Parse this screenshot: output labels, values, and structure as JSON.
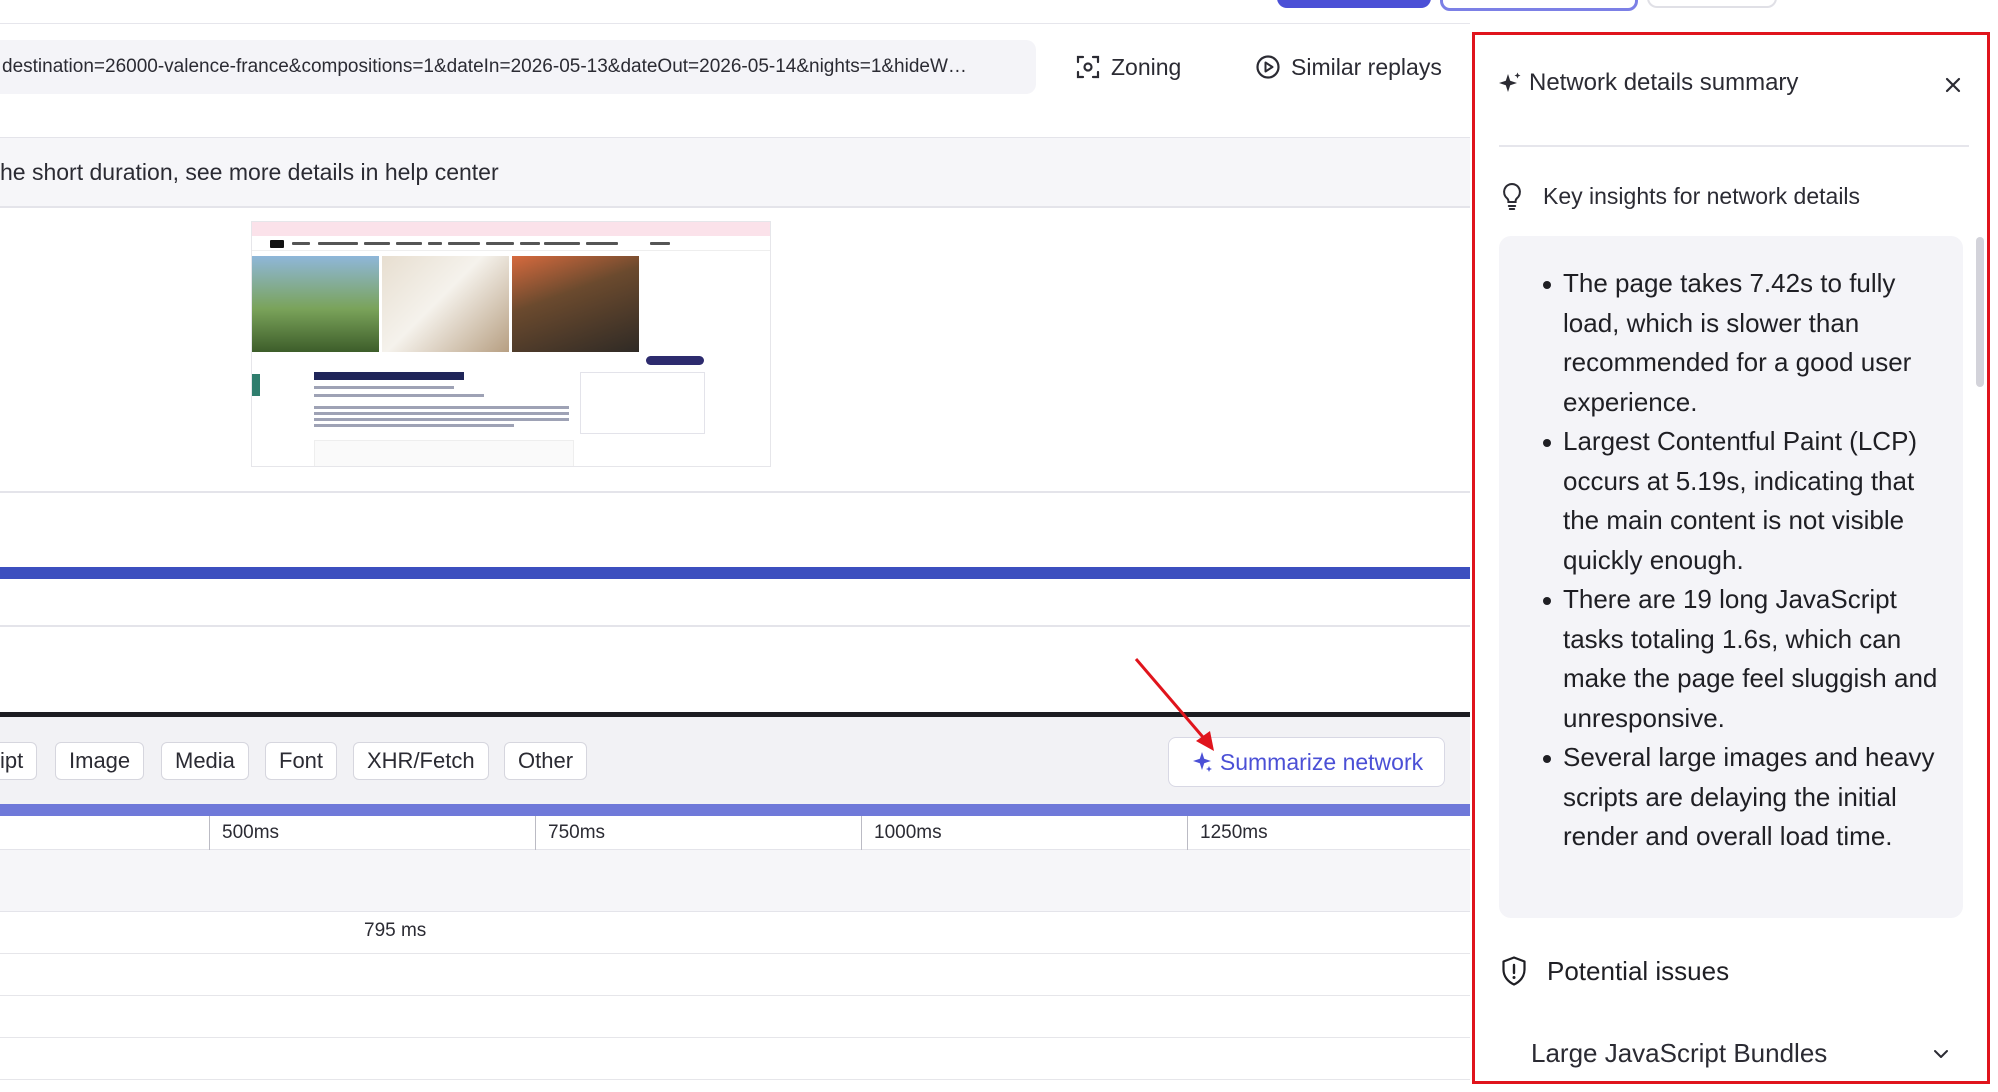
{
  "header": {
    "url": "destination=26000-valence-france&compositions=1&dateIn=2026-05-13&dateOut=2026-05-14&nights=1&hideW…",
    "zoning_label": "Zoning",
    "similar_replays_label": "Similar replays"
  },
  "notice": {
    "text": "he short duration, see more details in help center"
  },
  "filters": {
    "chips": [
      "ipt",
      "Image",
      "Media",
      "Font",
      "XHR/Fetch",
      "Other"
    ],
    "summarize_label": "Summarize network"
  },
  "timeline": {
    "ticks": [
      "500ms",
      "750ms",
      "1000ms",
      "1250ms"
    ],
    "row_duration": "795 ms"
  },
  "panel": {
    "title": "Network details summary",
    "insights_heading": "Key insights for network details",
    "insights": [
      "The page takes 7.42s to fully load, which is slower than recommended for a good user experience.",
      "Largest Contentful Paint (LCP) occurs at 5.19s, indicating that the main content is not visible quickly enough.",
      "There are 19 long JavaScript tasks totaling 1.6s, which can make the page feel sluggish and unresponsive.",
      "Several large images and heavy scripts are delaying the initial render and overall load time."
    ],
    "issues_heading": "Potential issues",
    "issue_item": "Large JavaScript Bundles"
  },
  "colors": {
    "accent": "#4b50d6",
    "highlight_border": "#e0141c",
    "arrow": "#e0141c"
  },
  "icons": {
    "zoning": "zoning-frame-icon",
    "similar": "play-circle-icon",
    "sparkle": "sparkle-icon",
    "close": "close-icon",
    "bulb": "lightbulb-icon",
    "shield": "shield-alert-icon",
    "chevron": "chevron-down-icon"
  }
}
